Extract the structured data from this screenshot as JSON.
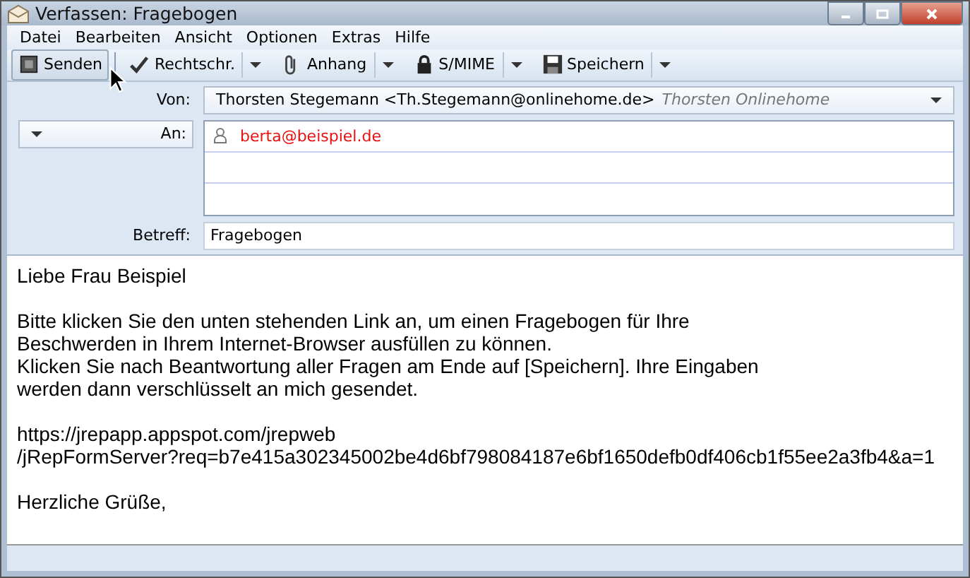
{
  "window": {
    "title": "Verfassen: Fragebogen"
  },
  "menu": [
    "Datei",
    "Bearbeiten",
    "Ansicht",
    "Optionen",
    "Extras",
    "Hilfe"
  ],
  "toolbar": [
    {
      "label": "Senden",
      "kind": "send"
    },
    {
      "label": "Rechtschr.",
      "kind": "spelling"
    },
    {
      "label": "Anhang",
      "kind": "attach"
    },
    {
      "label": "S/MIME",
      "kind": "security"
    },
    {
      "label": "Speichern",
      "kind": "save"
    }
  ],
  "from": {
    "label": "Von:",
    "name": "Thorsten Stegemann <Th.Stegemann@onlinehome.de>",
    "account": "Thorsten Onlinehome"
  },
  "recipients": {
    "type_label": "An:",
    "rows": [
      {
        "address": "berta@beispiel.de"
      }
    ]
  },
  "subject": {
    "label": "Betreff:",
    "value": "Fragebogen"
  },
  "body": [
    [
      "Liebe Frau Beispiel"
    ],
    [
      "Bitte klicken Sie den unten stehenden Link an, um einen Fragebogen für Ihre",
      "Beschwerden in Ihrem Internet-Browser ausfüllen zu können.",
      "Klicken Sie nach Beantwortung aller Fragen am Ende auf [Speichern]. Ihre Eingaben",
      "werden dann verschlüsselt an mich gesendet."
    ],
    [
      "https://jrepapp.appspot.com/jrepweb",
      "/jRepFormServer?req=b7e415a302345002be4d6bf798084187e6bf1650defb0df406cb1f55ee2a3fb4&a=1"
    ],
    [
      "Herzliche Grüße,"
    ]
  ]
}
